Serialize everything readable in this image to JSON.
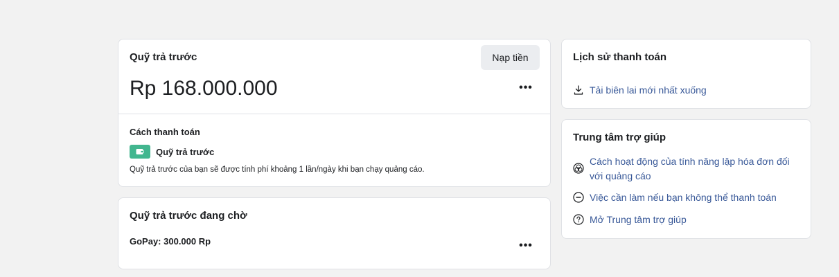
{
  "prepaid": {
    "title": "Quỹ trả trước",
    "topup_label": "Nạp tiền",
    "balance": "Rp 168.000.000",
    "more": "•••",
    "payment_method_title": "Cách thanh toán",
    "method_label": "Quỹ trả trước",
    "note": "Quỹ trả trước của bạn sẽ được tính phí khoảng 1 lần/ngày khi bạn chạy quảng cáo.",
    "badge_color": "#42b68f"
  },
  "pending": {
    "title": "Quỹ trả trước đang chờ",
    "item": "GoPay: 300.000 Rp",
    "more": "•••"
  },
  "history": {
    "title": "Lịch sử thanh toán",
    "link_label": "Tải biên lai mới nhất xuống",
    "link_icon": "download-icon"
  },
  "help": {
    "title": "Trung tâm trợ giúp",
    "links": [
      {
        "label": "Cách hoạt động của tính năng lập hóa đơn đối với quảng cáo",
        "icon": "circles-icon"
      },
      {
        "label": "Việc cần làm nếu bạn không thể thanh toán",
        "icon": "minus-circle-icon"
      },
      {
        "label": "Mở Trung tâm trợ giúp",
        "icon": "question-circle-icon"
      }
    ]
  },
  "colors": {
    "link": "#385898",
    "background": "#f2f2f2"
  }
}
